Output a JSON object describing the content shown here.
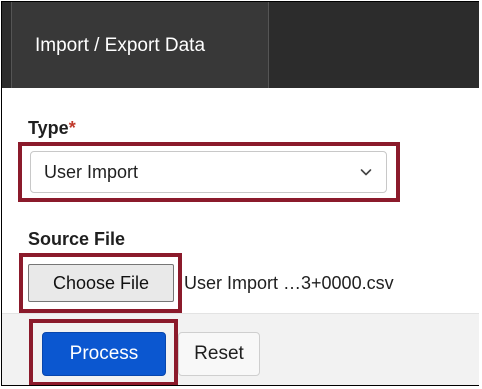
{
  "header": {
    "tab_label": "Import / Export Data"
  },
  "form": {
    "type_label": "Type",
    "required_marker": "*",
    "type_value": "User Import",
    "source_file_label": "Source File",
    "choose_file_label": "Choose File",
    "file_name": "User Import …3+0000.csv"
  },
  "actions": {
    "process_label": "Process",
    "reset_label": "Reset"
  },
  "icons": {
    "dropdown": "chevron-down-icon"
  },
  "colors": {
    "header_bg": "#2c2c2c",
    "tab_bg": "#383838",
    "primary_button": "#0b57d0",
    "required": "#c0392b",
    "highlight_box": "#8b1a2b"
  }
}
